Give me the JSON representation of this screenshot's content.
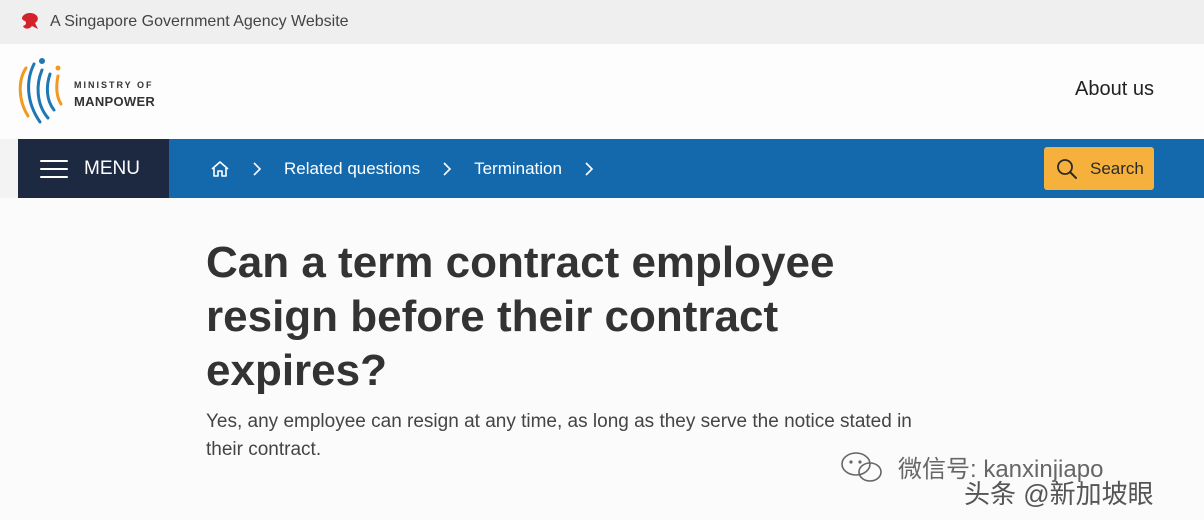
{
  "masthead": {
    "text": "A Singapore Government Agency Website",
    "icon": "lion-head-icon",
    "icon_color": "#d2232a"
  },
  "header": {
    "logo": {
      "line1": "MINISTRY OF",
      "line2": "MANPOWER"
    },
    "about_label": "About us"
  },
  "navbar": {
    "menu_label": "MENU",
    "breadcrumbs": [
      {
        "icon": "home-icon"
      },
      {
        "label": "Related questions"
      },
      {
        "label": "Termination"
      }
    ],
    "search_label": "Search",
    "colors": {
      "bar": "#1469ad",
      "menu": "#1d2940",
      "search": "#f5b13b"
    }
  },
  "main": {
    "title": "Can a term contract employee resign before their contract expires?",
    "description": "Yes, any employee can resign at any time, as long as they serve the notice stated in their contract."
  },
  "watermark": {
    "line1": "微信号: kanxinjiapo",
    "line2": "头条 @新加坡眼"
  }
}
